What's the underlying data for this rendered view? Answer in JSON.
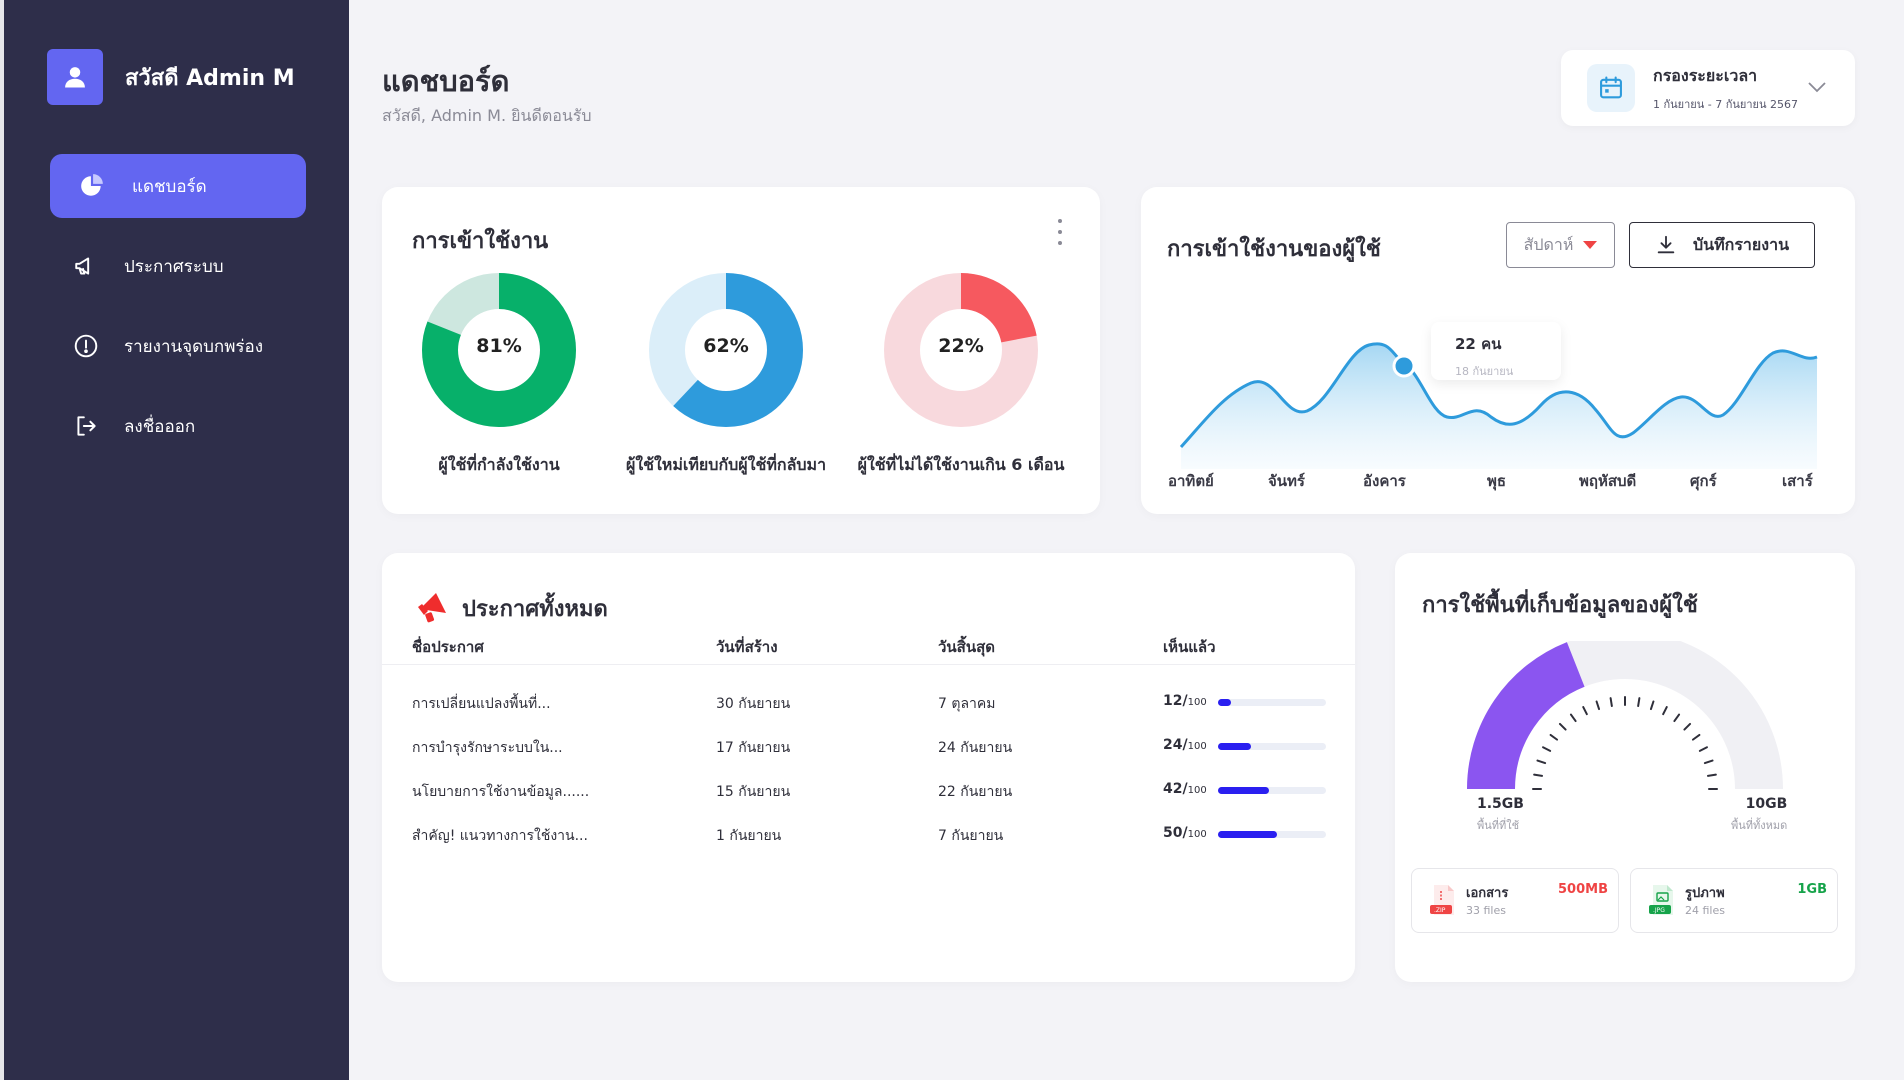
{
  "sidebar": {
    "greeting": "สวัสดี Admin M",
    "items": [
      {
        "label": "แดชบอร์ด",
        "icon": "pie-chart-icon",
        "active": true
      },
      {
        "label": "ประกาศระบบ",
        "icon": "megaphone-icon"
      },
      {
        "label": "รายงานจุดบกพร่อง",
        "icon": "alert-circle-icon"
      },
      {
        "label": "ลงชื่อออก",
        "icon": "logout-icon"
      }
    ]
  },
  "header": {
    "title": "แดชบอร์ด",
    "subtitle": "สวัสดี, Admin M. ยินดีตอนรับ"
  },
  "filter": {
    "label": "กรองระยะเวลา",
    "range": "1 กันยายน - 7 กันยายน  2567"
  },
  "usage": {
    "title": "การเข้าใช้งาน",
    "donuts": [
      {
        "percent": 81,
        "text": "81%",
        "label": "ผู้ใช้ที่กำลังใช้งาน",
        "color": "#07b06a",
        "track": "#cde7df"
      },
      {
        "percent": 62,
        "text": "62%",
        "label": "ผู้ใช้ใหม่เทียบกับผู้ใช้ที่กลับมา",
        "color": "#2e9bdc",
        "track": "#dbeef9"
      },
      {
        "percent": 22,
        "text": "22%",
        "label": "ผู้ใช้ที่ไม่ได้ใช้งานเกิน 6 เดือน",
        "color": "#f6595f",
        "track": "#f8d9dd"
      }
    ]
  },
  "user_trend": {
    "title": "การเข้าใช้งานของผู้ใช้",
    "period_select": "สัปดาห์",
    "save_button": "บันทึกรายงาน",
    "tooltip_value": "22   คน",
    "tooltip_date": "18 กันยายน",
    "days": [
      "อาทิตย์",
      "จันทร์",
      "อังคาร",
      "พุธ",
      "พฤหัสบดี",
      "ศุกร์",
      "เสาร์"
    ],
    "line_color": "#2e9bdc"
  },
  "announcements": {
    "title": "ประกาศทั้งหมด",
    "columns": [
      "ชื่อประกาศ",
      "วันที่สร้าง",
      "วันสิ้นสุด",
      "เห็นแล้ว"
    ],
    "rows": [
      {
        "name": "การเปลี่ยนแปลงพื้นที่...",
        "created": "30 กันยายน",
        "end": "7 ตุลาคม",
        "seen": "12/",
        "total": "100",
        "fraction": 0.12
      },
      {
        "name": "การบำรุงรักษาระบบใน...",
        "created": "17 กันยายน",
        "end": "24 กันยายน",
        "seen": "24/",
        "total": "100",
        "fraction": 0.31
      },
      {
        "name": "นโยบายการใช้งานข้อมูล......",
        "created": "15 กันยายน",
        "end": "22 กันยายน",
        "seen": "42/",
        "total": "100",
        "fraction": 0.47
      },
      {
        "name": "สำคัญ! แนวทางการใช้งาน...",
        "created": "1 กันยายน",
        "end": "7 กันยายน",
        "seen": "50/",
        "total": "100",
        "fraction": 0.55
      }
    ]
  },
  "storage": {
    "title": "การใช้พื้นที่เก็บข้อมูลของผู้ใช้",
    "used": "1.5GB",
    "used_label": "พื้นที่ที่ใช้",
    "total": "10GB",
    "total_label": "พื้นที่ทั้งหมด",
    "used_fraction": 0.38,
    "files": [
      {
        "name": "เอกสาร",
        "count": "33 files",
        "size": "500MB",
        "color": "#ef4444",
        "badge": ".ZIP",
        "icon": "zip-file-icon"
      },
      {
        "name": "รูปภาพ",
        "count": "24 files",
        "size": "1GB",
        "color": "#16a34a",
        "badge": ".JPG",
        "icon": "image-file-icon"
      }
    ]
  }
}
